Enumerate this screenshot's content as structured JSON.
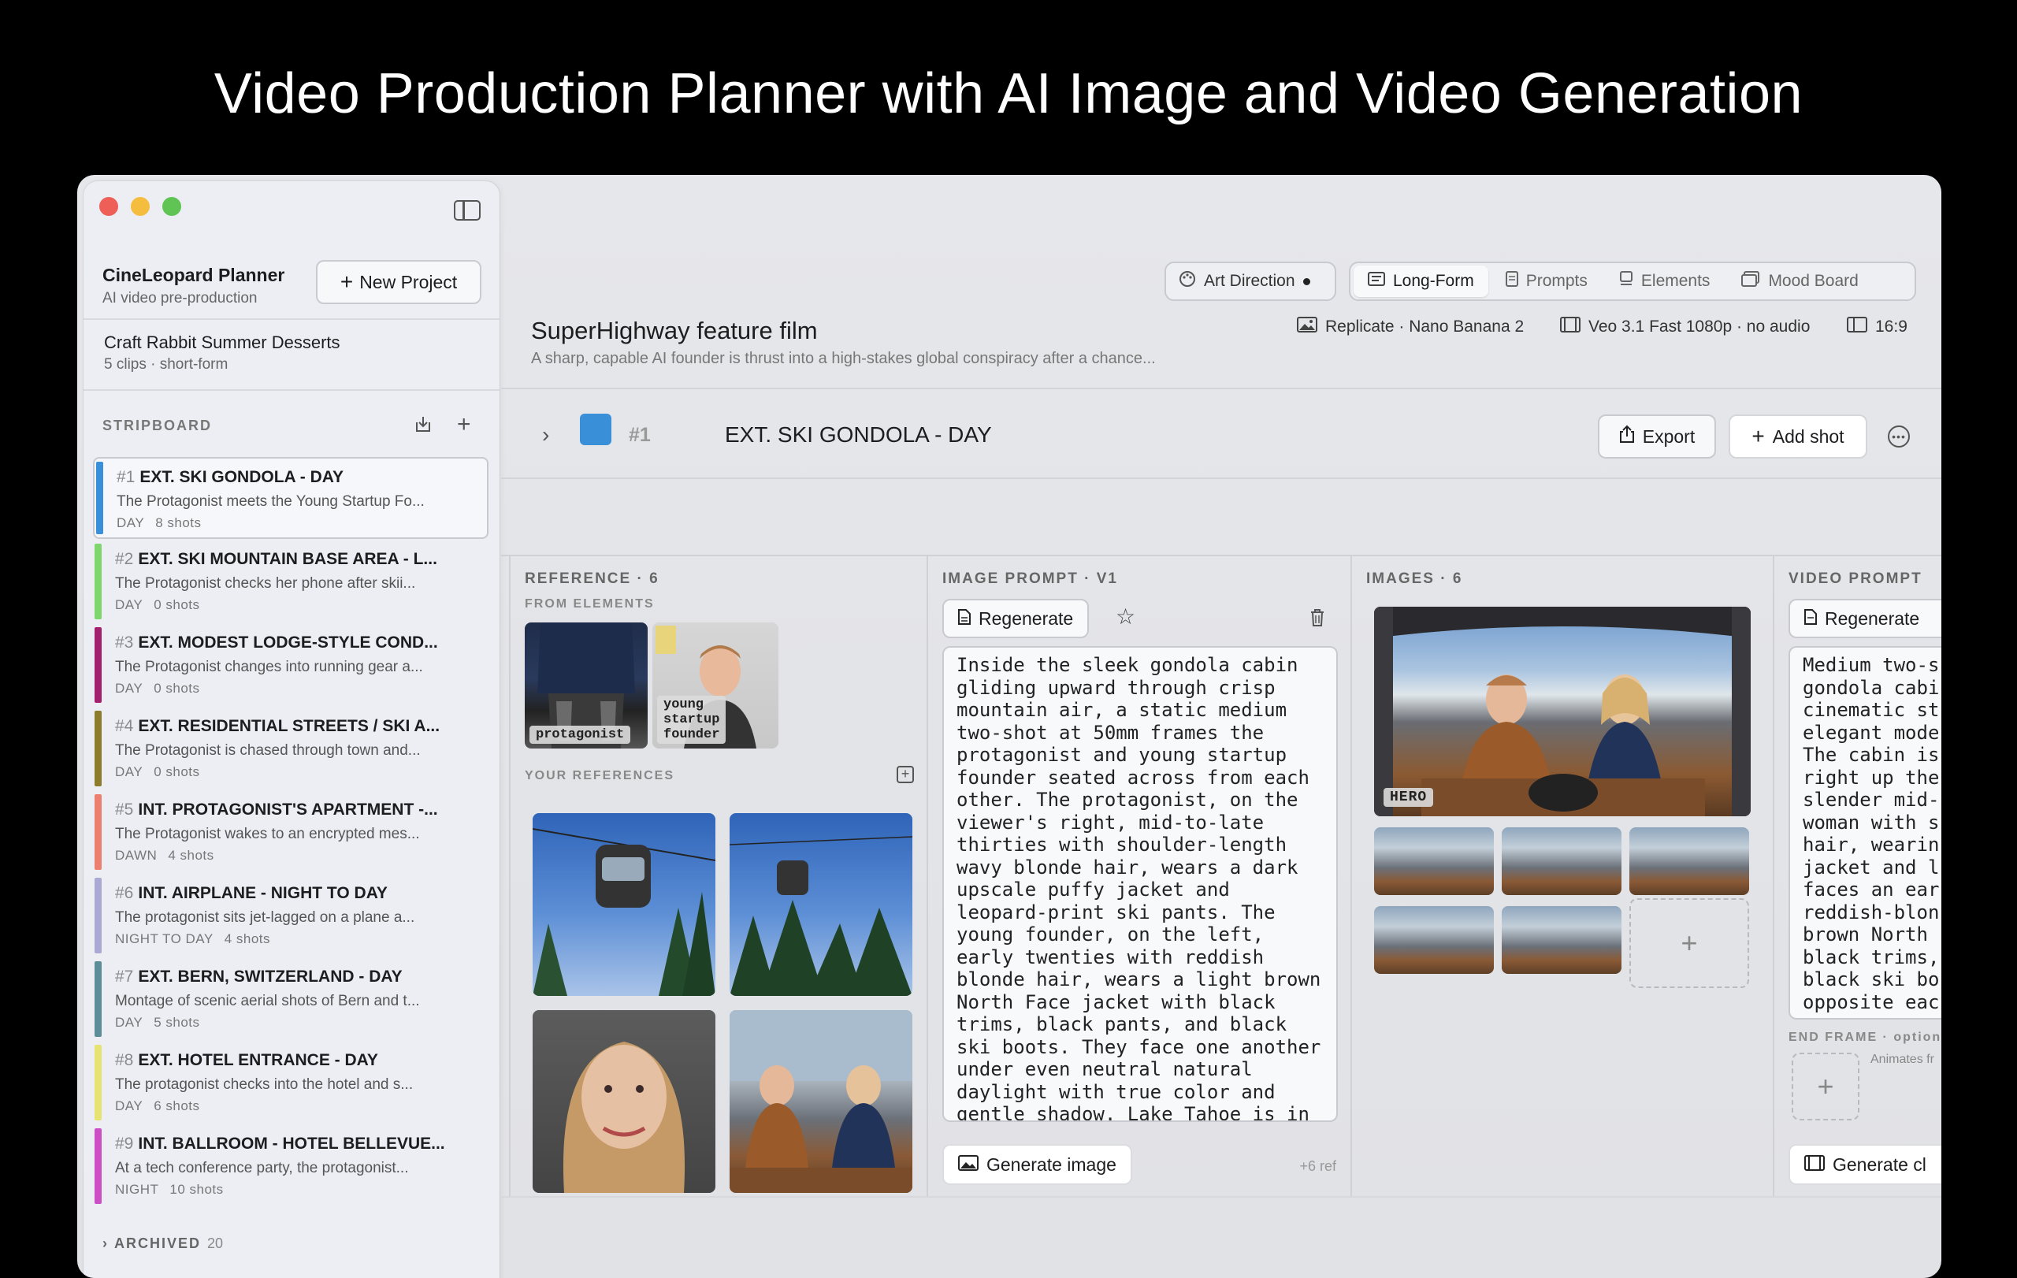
{
  "headline": "Video Production Planner with AI Image and Video Generation",
  "sidebar": {
    "app_title": "CineLeopard Planner",
    "app_subtitle": "AI video pre-production",
    "new_project_label": "New Project",
    "project": {
      "name": "Craft Rabbit Summer Desserts",
      "meta": "5 clips · short-form"
    },
    "stripboard_label": "STRIPBOARD",
    "scenes": [
      {
        "num": "#1",
        "title": "EXT. SKI GONDOLA - DAY",
        "desc": "The Protagonist meets the Young Startup Fo...",
        "time": "DAY",
        "shots": "8 shots",
        "color": "#3a8fd9"
      },
      {
        "num": "#2",
        "title": "EXT. SKI MOUNTAIN BASE AREA - L...",
        "desc": "The Protagonist checks her phone after skii...",
        "time": "DAY",
        "shots": "0 shots",
        "color": "#7ed66d"
      },
      {
        "num": "#3",
        "title": "EXT. MODEST LODGE-STYLE COND...",
        "desc": "The Protagonist changes into running gear a...",
        "time": "DAY",
        "shots": "0 shots",
        "color": "#a3206e"
      },
      {
        "num": "#4",
        "title": "EXT. RESIDENTIAL STREETS / SKI A...",
        "desc": "The Protagonist is chased through town and...",
        "time": "DAY",
        "shots": "0 shots",
        "color": "#8c7c2c"
      },
      {
        "num": "#5",
        "title": "INT. PROTAGONIST'S APARTMENT -...",
        "desc": "The Protagonist wakes to an encrypted mes...",
        "time": "DAWN",
        "shots": "4 shots",
        "color": "#ec806e"
      },
      {
        "num": "#6",
        "title": "INT. AIRPLANE - NIGHT TO DAY",
        "desc": "The protagonist sits jet-lagged on a plane a...",
        "time": "NIGHT TO DAY",
        "shots": "4 shots",
        "color": "#a9a9d4"
      },
      {
        "num": "#7",
        "title": "EXT. BERN, SWITZERLAND - DAY",
        "desc": "Montage of scenic aerial shots of Bern and t...",
        "time": "DAY",
        "shots": "5 shots",
        "color": "#5d8d99"
      },
      {
        "num": "#8",
        "title": "EXT. HOTEL ENTRANCE - DAY",
        "desc": "The protagonist checks into the hotel and s...",
        "time": "DAY",
        "shots": "6 shots",
        "color": "#e6e373"
      },
      {
        "num": "#9",
        "title": "INT. BALLROOM - HOTEL BELLEVUE...",
        "desc": "At a tech conference party, the protagonist...",
        "time": "NIGHT",
        "shots": "10 shots",
        "color": "#cc4fc6"
      }
    ],
    "archived_label": "ARCHIVED",
    "archived_count": "20"
  },
  "toolbar": {
    "art_direction": "Art Direction",
    "tabs": [
      "Long-Form",
      "Prompts",
      "Elements",
      "Mood Board"
    ],
    "active_tab": "Long-Form"
  },
  "film": {
    "title": "SuperHighway feature film",
    "logline": "A sharp, capable AI founder is thrust into a high-stakes global conspiracy after a chance...",
    "image_model": "Replicate · Nano Banana 2",
    "video_model": "Veo 3.1 Fast 1080p · no audio",
    "aspect": "16:9"
  },
  "shot": {
    "num": "#1",
    "title": "EXT. SKI GONDOLA - DAY",
    "export_label": "Export",
    "add_shot_label": "Add shot"
  },
  "reference": {
    "header": "REFERENCE · 6",
    "from_elements": "FROM ELEMENTS",
    "elements": [
      "protagonist",
      "young\nstartup\nfounder"
    ],
    "your_references": "YOUR REFERENCES"
  },
  "image_prompt": {
    "header": "IMAGE PROMPT · V1",
    "regenerate_label": "Regenerate",
    "text": "Inside the sleek gondola cabin gliding upward through crisp mountain air, a static medium two-shot at 50mm frames the protagonist and young startup founder seated across from each other. The protagonist, on the viewer's right, mid-to-late thirties with shoulder-length wavy blonde hair, wears a dark upscale puffy jacket and leopard-print ski pants. The young founder, on the left, early twenties with reddish blonde hair, wears a light brown North Face jacket with black trims, black pants, and black ski boots. They face one another under even neutral natural daylight with true color and gentle shadow. Lake Tahoe is in",
    "generate_label": "Generate image",
    "ref_count": "+6 ref"
  },
  "images": {
    "header": "IMAGES · 6",
    "hero_label": "HERO"
  },
  "video_prompt": {
    "header": "VIDEO PROMPT",
    "regenerate_label": "Regenerate",
    "text": "Medium two-s\ngondola cabi\ncinematic st\nelegant mode\nThe cabin is\nright up the\nslender mid-\nwoman with s\nhair, wearin\njacket and l\nfaces an ear\nreddish-blon\nbrown North\nblack trims,\nblack ski bo\nopposite eac",
    "end_frame": "END FRAME · option",
    "animates": "Animates fr",
    "generate_label": "Generate cl"
  }
}
